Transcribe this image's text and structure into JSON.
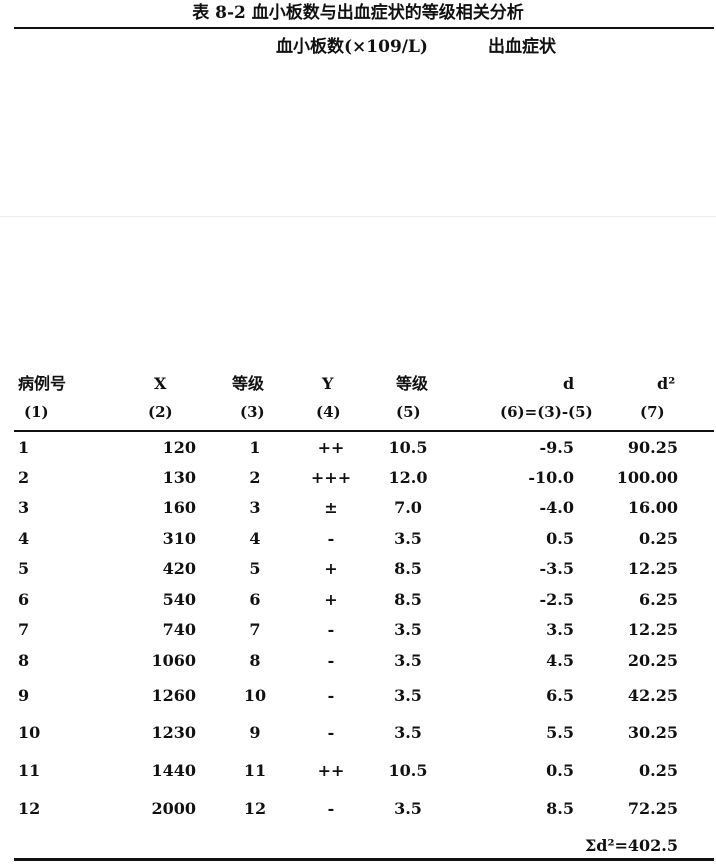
{
  "title": "表 8-2  血小板数与出血症状的等级相关分析",
  "group_headers": {
    "platelet": "血小板数(×109/L)",
    "bleeding": "出血症状"
  },
  "columns": [
    {
      "label": "病例号",
      "index": "(1)"
    },
    {
      "label": "X",
      "index": "(2)"
    },
    {
      "label": "等级",
      "index": "(3)"
    },
    {
      "label": "Y",
      "index": "(4)"
    },
    {
      "label": "等级",
      "index": "(5)"
    },
    {
      "label": "d",
      "index": "(6)=(3)-(5)"
    },
    {
      "label": "d²",
      "index": "(7)"
    }
  ],
  "rows": [
    {
      "case": "1",
      "x": "120",
      "x_rank": "1",
      "y": "++",
      "y_rank": "10.5",
      "d": "-9.5",
      "d2": "90.25"
    },
    {
      "case": "2",
      "x": "130",
      "x_rank": "2",
      "y": "+++",
      "y_rank": "12.0",
      "d": "-10.0",
      "d2": "100.00"
    },
    {
      "case": "3",
      "x": "160",
      "x_rank": "3",
      "y": "±",
      "y_rank": "7.0",
      "d": "-4.0",
      "d2": "16.00"
    },
    {
      "case": "4",
      "x": "310",
      "x_rank": "4",
      "y": "-",
      "y_rank": "3.5",
      "d": "0.5",
      "d2": "0.25"
    },
    {
      "case": "5",
      "x": "420",
      "x_rank": "5",
      "y": "+",
      "y_rank": "8.5",
      "d": "-3.5",
      "d2": "12.25"
    },
    {
      "case": "6",
      "x": "540",
      "x_rank": "6",
      "y": "+",
      "y_rank": "8.5",
      "d": "-2.5",
      "d2": "6.25"
    },
    {
      "case": "7",
      "x": "740",
      "x_rank": "7",
      "y": "-",
      "y_rank": "3.5",
      "d": "3.5",
      "d2": "12.25"
    },
    {
      "case": "8",
      "x": "1060",
      "x_rank": "8",
      "y": "-",
      "y_rank": "3.5",
      "d": "4.5",
      "d2": "20.25"
    },
    {
      "case": "9",
      "x": "1260",
      "x_rank": "10",
      "y": "-",
      "y_rank": "3.5",
      "d": "6.5",
      "d2": "42.25"
    },
    {
      "case": "10",
      "x": "1230",
      "x_rank": "9",
      "y": "-",
      "y_rank": "3.5",
      "d": "5.5",
      "d2": "30.25"
    },
    {
      "case": "11",
      "x": "1440",
      "x_rank": "11",
      "y": "++",
      "y_rank": "10.5",
      "d": "0.5",
      "d2": "0.25"
    },
    {
      "case": "12",
      "x": "2000",
      "x_rank": "12",
      "y": "-",
      "y_rank": "3.5",
      "d": "8.5",
      "d2": "72.25"
    }
  ],
  "sum": "Σd²=402.5"
}
